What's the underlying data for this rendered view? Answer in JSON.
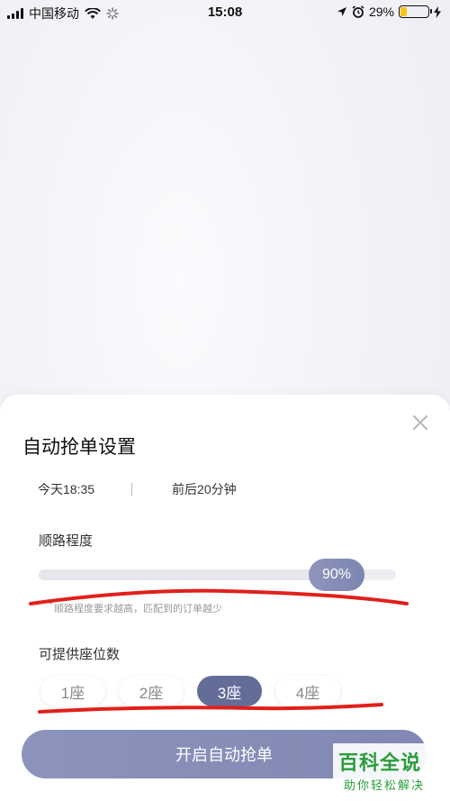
{
  "status_bar": {
    "carrier": "中国移动",
    "time": "15:08",
    "battery_text": "29%",
    "battery_level": 0.29,
    "battery_color": "#f5c518"
  },
  "sheet": {
    "title": "自动抢单设置",
    "date_time": "今天18:35",
    "window": "前后20分钟",
    "route_label": "顺路程度",
    "route_value_text": "90%",
    "route_value": 0.9,
    "route_hint": "顺路程度要求越高，匹配到的订单越少",
    "seats_label": "可提供座位数",
    "seat_options": [
      "1座",
      "2座",
      "3座",
      "4座"
    ],
    "selected_seat": "3座",
    "cta_label": "开启自动抢单"
  },
  "watermark": {
    "line1": "百科全说",
    "line2": "助你轻松解决"
  },
  "colors": {
    "accent": "#636d98",
    "cta": "#8a92bb",
    "annotation_red": "#e0201a"
  }
}
